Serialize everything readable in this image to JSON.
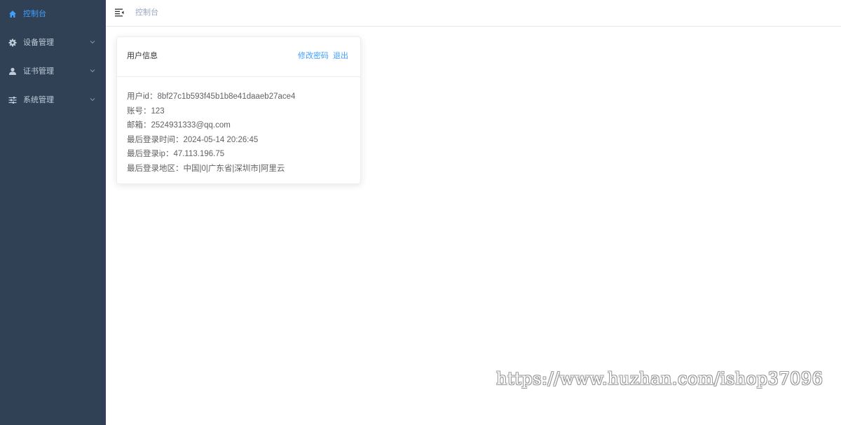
{
  "sidebar": {
    "items": [
      {
        "label": "控制台",
        "icon": "home-icon",
        "active": true,
        "has_arrow": false
      },
      {
        "label": "设备管理",
        "icon": "gear-icon",
        "active": false,
        "has_arrow": true
      },
      {
        "label": "证书管理",
        "icon": "user-icon",
        "active": false,
        "has_arrow": true
      },
      {
        "label": "系统管理",
        "icon": "sliders-icon",
        "active": false,
        "has_arrow": true
      }
    ],
    "bg_color": "#304156",
    "active_color": "#409eff"
  },
  "topbar": {
    "breadcrumb": "控制台",
    "toggle_icon": "hamburger-icon"
  },
  "card": {
    "title": "用户信息",
    "change_password_label": "修改密码",
    "logout_label": "退出",
    "rows": [
      "用户id：8bf27c1b593f45b1b8e41daaeb27ace4",
      "账号：123",
      "邮箱：2524931333@qq.com",
      "最后登录时间：2024-05-14 20:26:45",
      "最后登录ip：47.113.196.75",
      "最后登录地区：中国|0|广东省|深圳市|阿里云"
    ]
  },
  "watermark": "https://www.huzhan.com/ishop37096"
}
